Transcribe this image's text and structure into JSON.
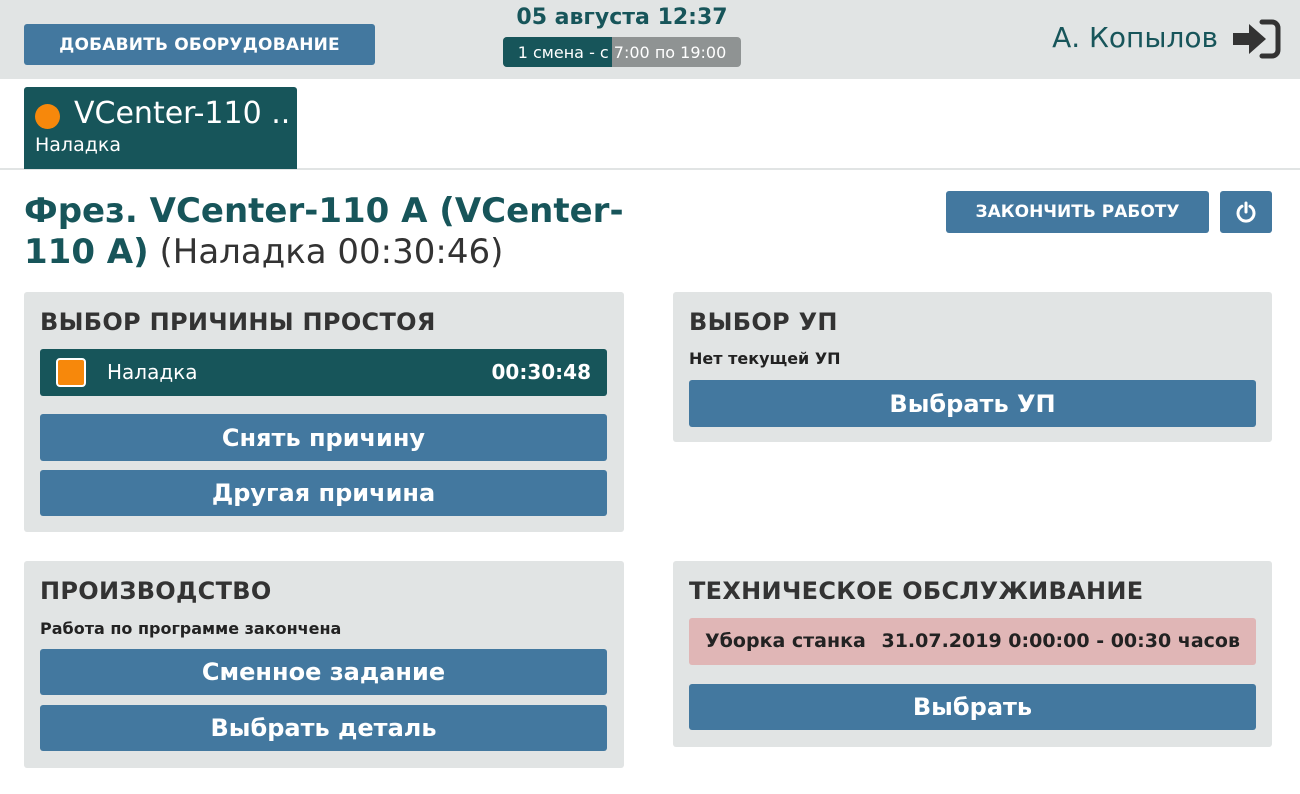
{
  "header": {
    "add_equipment_label": "ДОБАВИТЬ ОБОРУДОВАНИЕ",
    "datetime": "05 августа 12:37",
    "shift": {
      "text": "1 смена - с 7:00 по 19:00",
      "progress": 0.46
    },
    "user_name": "А. Копылов",
    "logout_icon": "logout-arrow-icon"
  },
  "machine_tab": {
    "title": "VCenter-110 ..",
    "status": "Наладка",
    "status_color": "#f7880b"
  },
  "machine": {
    "name": "Фрез. VCenter-110 A (VCenter-110 A)",
    "state_text": "(Наладка 00:30:46)"
  },
  "actions": {
    "finish_label": "ЗАКОНЧИТЬ РАБОТУ",
    "power_icon": "power-icon"
  },
  "downtime": {
    "title": "ВЫБОР ПРИЧИНЫ ПРОСТОЯ",
    "current_reason": {
      "label": "Наладка",
      "time": "00:30:48",
      "color": "#f7880b"
    },
    "remove_label": "Снять причину",
    "other_label": "Другая причина"
  },
  "program": {
    "title": "ВЫБОР УП",
    "note": "Нет текущей УП",
    "select_label": "Выбрать УП"
  },
  "production": {
    "title": "ПРОИЗВОДСТВО",
    "note": "Работа по программе закончена",
    "shift_task_label": "Сменное задание",
    "select_part_label": "Выбрать деталь"
  },
  "maintenance": {
    "title": "ТЕХНИЧЕСКОЕ ОБСЛУЖИВАНИЕ",
    "item": {
      "name": "Уборка станка",
      "when": "31.07.2019 0:00:00 - 00:30 часов"
    },
    "select_label": "Выбрать"
  },
  "colors": {
    "primary": "#43789f",
    "dark_teal": "#17555a",
    "panel_bg": "#e1e4e4",
    "alert_bg": "#e0b6b6"
  }
}
